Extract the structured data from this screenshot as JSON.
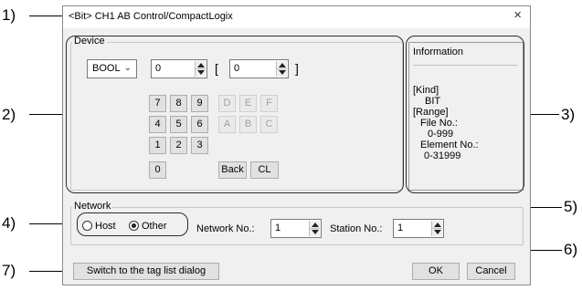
{
  "window": {
    "title": "<Bit> CH1 AB Control/CompactLogix",
    "close_glyph": "×"
  },
  "callouts": {
    "c1": "1)",
    "c2": "2)",
    "c3": "3)",
    "c4": "4)",
    "c5": "5)",
    "c6": "6)",
    "c7": "7)"
  },
  "device": {
    "group_label": "Device",
    "type_select": "BOOL",
    "file_value": "0",
    "element_value": "0",
    "bracket_open": "[",
    "bracket_close": "]",
    "keys": [
      "7",
      "8",
      "9",
      "D",
      "E",
      "F",
      "4",
      "5",
      "6",
      "A",
      "B",
      "C",
      "1",
      "2",
      "3",
      "0"
    ],
    "back_label": "Back",
    "clear_label": "CL"
  },
  "information": {
    "title": "Information",
    "lines": [
      "[Kind]",
      "BIT",
      "[Range]",
      "File No.:",
      "0-999",
      "Element No.:",
      "0-31999"
    ]
  },
  "network": {
    "group_label": "Network",
    "host_label": "Host",
    "other_label": "Other",
    "selected": "Other",
    "network_no_label": "Network No.:",
    "network_no_value": "1",
    "station_no_label": "Station No.:",
    "station_no_value": "1"
  },
  "footer": {
    "switch_label": "Switch to the tag list dialog",
    "ok_label": "OK",
    "cancel_label": "Cancel"
  }
}
